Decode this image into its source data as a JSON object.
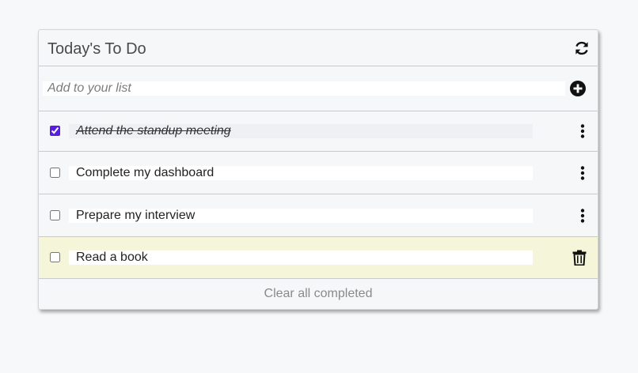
{
  "header": {
    "title": "Today's To Do",
    "refresh_icon": "refresh-icon"
  },
  "add": {
    "placeholder": "Add to your list",
    "value": "",
    "add_icon": "plus-circle-icon"
  },
  "items": [
    {
      "label": "Attend the standup meeting",
      "completed": true,
      "action_icon": "kebab-menu-icon"
    },
    {
      "label": "Complete my dashboard",
      "completed": false,
      "action_icon": "kebab-menu-icon"
    },
    {
      "label": "Prepare my interview",
      "completed": false,
      "action_icon": "kebab-menu-icon"
    },
    {
      "label": "Read a book",
      "completed": false,
      "action_icon": "trash-icon",
      "highlighted": true
    }
  ],
  "footer": {
    "clear_label": "Clear all completed"
  },
  "colors": {
    "checkbox_accent": "#5a1ee0",
    "highlight_row": "#f5f6d9",
    "background": "#f7f8fa"
  }
}
